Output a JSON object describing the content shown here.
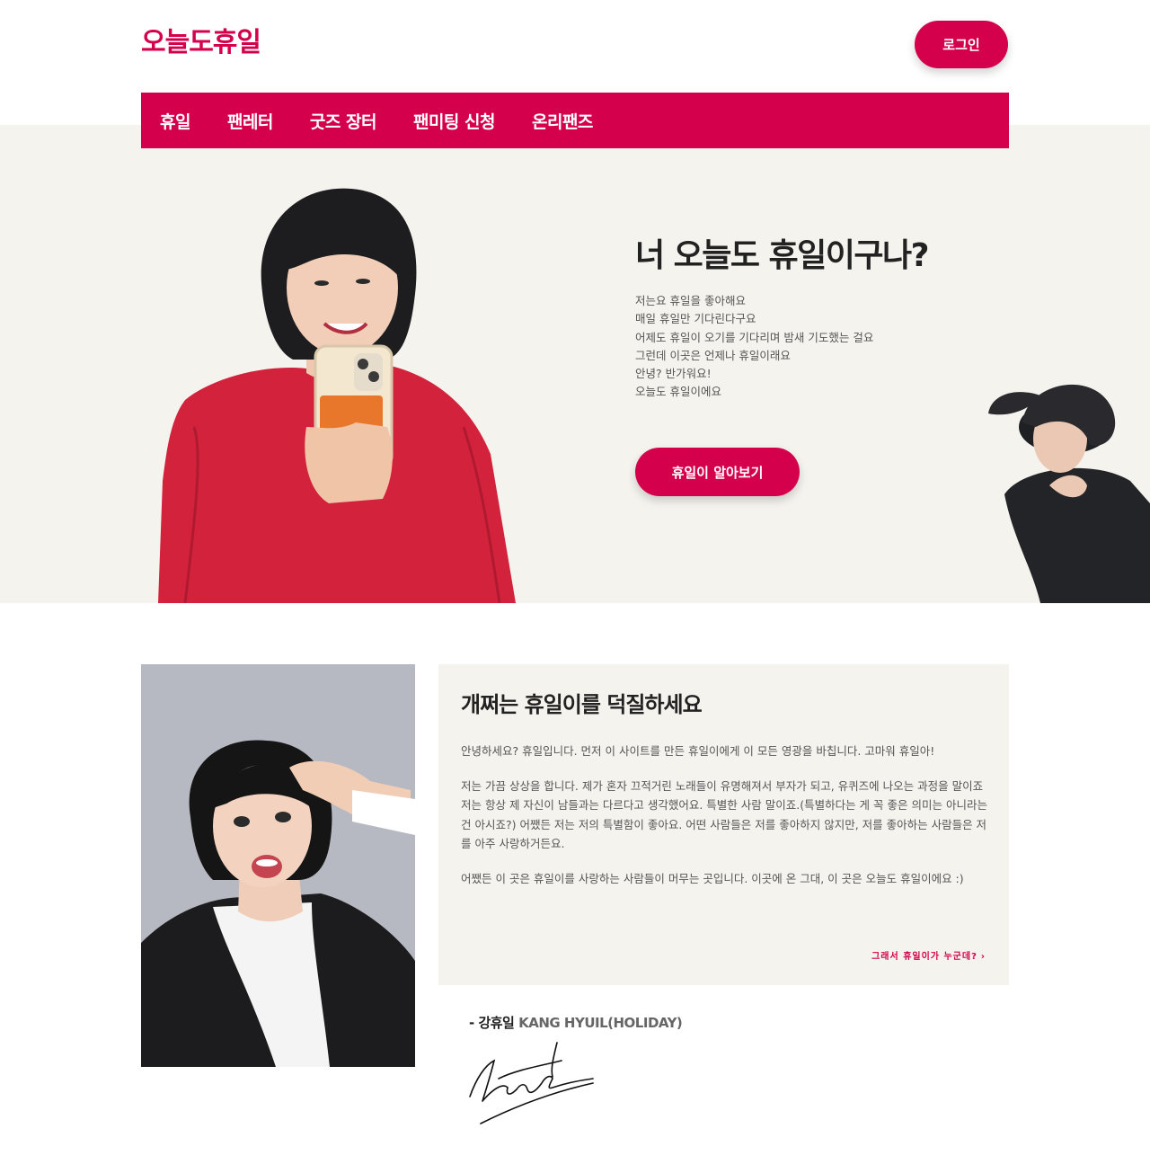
{
  "header": {
    "logo": "오늘도휴일",
    "login_label": "로그인"
  },
  "nav": {
    "items": [
      "휴일",
      "팬레터",
      "굿즈 장터",
      "팬미팅 신청",
      "온리팬즈"
    ]
  },
  "hero": {
    "title": "너 오늘도 휴일이구나?",
    "lines": [
      "저는요 휴일을 좋아해요",
      "매일 휴일만 기다린다구요",
      "어제도 휴일이 오기를 기다리며 밤새 기도했는 걸요",
      "그런데 이곳은 언제나 휴일이래요",
      "안녕? 반가워요!",
      "오늘도 휴일이에요"
    ],
    "button_label": "휴일이 알아보기"
  },
  "intro": {
    "title": "개쩌는 휴일이를 덕질하세요",
    "paragraphs": [
      "안녕하세요? 휴일입니다. 먼저 이 사이트를 만든 휴일이에게 이 모든 영광을 바칩니다. 고마워 휴일아!",
      "저는 가끔 상상을 합니다. 제가 혼자 끄적거린 노래들이 유명해져서 부자가 되고, 유퀴즈에 나오는 과정을 말이죠 저는 항상 제 자신이 남들과는 다르다고 생각했어요. 특별한 사람 말이죠.(특별하다는 게 꼭 좋은 의미는 아니라는 건 아시죠?) 어쨌든 저는 저의 특별함이 좋아요. 어떤 사람들은 저를 좋아하지 않지만, 저를 좋아하는 사람들은 저를 아주 사랑하거든요.",
      "어쨌든 이 곳은 휴일이를 사랑하는 사람들이 머무는 곳입니다. 이곳에 온 그대, 이 곳은 오늘도 휴일이에요 :)"
    ],
    "link_label": "그래서 휴일이가 누군데?"
  },
  "signature": {
    "name_ko": "- 강휴일",
    "name_en": "KANG HYUIL(HOLIDAY)"
  },
  "colors": {
    "accent": "#d4004c",
    "hero_bg": "#f5f3ee",
    "card_bg": "#f5f3ee"
  }
}
